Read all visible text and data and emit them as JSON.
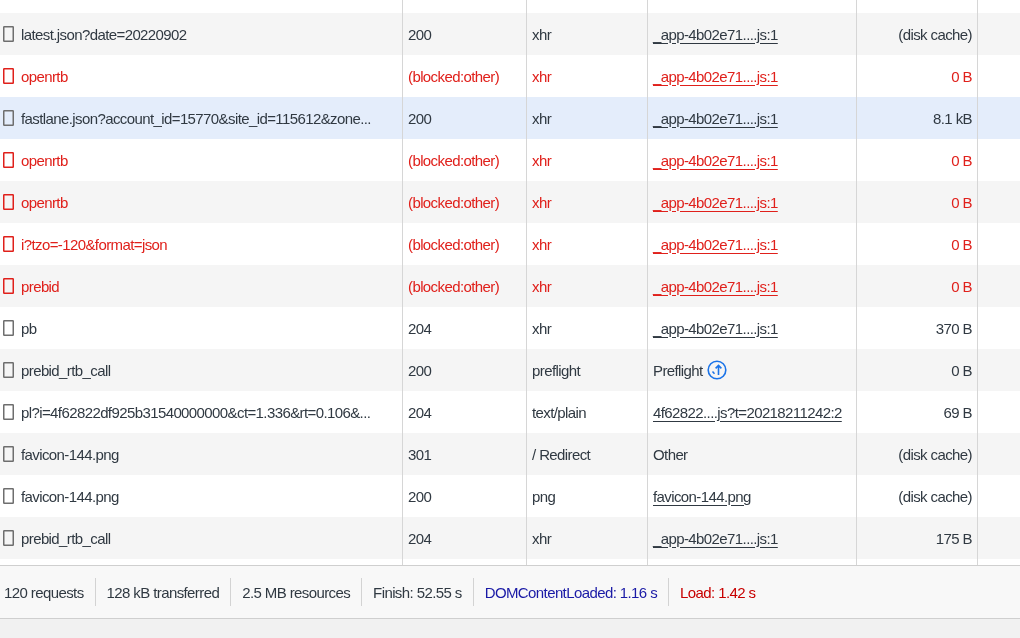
{
  "table": {
    "rows": [
      {
        "name": "latest.json?date=20220902",
        "status": "200",
        "type": "xhr",
        "initiator": {
          "text": "_app-4b02e71....js:1",
          "kind": "link"
        },
        "size": "(disk cache)",
        "blocked": false,
        "selected": false
      },
      {
        "name": "openrtb",
        "status": "(blocked:other)",
        "type": "xhr",
        "initiator": {
          "text": "_app-4b02e71....js:1",
          "kind": "link"
        },
        "size": "0 B",
        "blocked": true,
        "selected": false
      },
      {
        "name": "fastlane.json?account_id=15770&site_id=115612&zone...",
        "status": "200",
        "type": "xhr",
        "initiator": {
          "text": "_app-4b02e71....js:1",
          "kind": "link"
        },
        "size": "8.1 kB",
        "blocked": false,
        "selected": true
      },
      {
        "name": "openrtb",
        "status": "(blocked:other)",
        "type": "xhr",
        "initiator": {
          "text": "_app-4b02e71....js:1",
          "kind": "link"
        },
        "size": "0 B",
        "blocked": true,
        "selected": false
      },
      {
        "name": "openrtb",
        "status": "(blocked:other)",
        "type": "xhr",
        "initiator": {
          "text": "_app-4b02e71....js:1",
          "kind": "link"
        },
        "size": "0 B",
        "blocked": true,
        "selected": false
      },
      {
        "name": "i?tzo=-120&format=json",
        "status": "(blocked:other)",
        "type": "xhr",
        "initiator": {
          "text": "_app-4b02e71....js:1",
          "kind": "link"
        },
        "size": "0 B",
        "blocked": true,
        "selected": false
      },
      {
        "name": "prebid",
        "status": "(blocked:other)",
        "type": "xhr",
        "initiator": {
          "text": "_app-4b02e71....js:1",
          "kind": "link"
        },
        "size": "0 B",
        "blocked": true,
        "selected": false
      },
      {
        "name": "pb",
        "status": "204",
        "type": "xhr",
        "initiator": {
          "text": "_app-4b02e71....js:1",
          "kind": "link"
        },
        "size": "370 B",
        "blocked": false,
        "selected": false
      },
      {
        "name": "prebid_rtb_call",
        "status": "200",
        "type": "preflight",
        "initiator": {
          "text": "Preflight",
          "kind": "preflight"
        },
        "size": "0 B",
        "blocked": false,
        "selected": false
      },
      {
        "name": "pl?i=4f62822df925b31540000000&ct=1.336&rt=0.106&...",
        "status": "204",
        "type": "text/plain",
        "initiator": {
          "text": "4f62822....js?t=20218211242:2",
          "kind": "link"
        },
        "size": "69 B",
        "blocked": false,
        "selected": false
      },
      {
        "name": "favicon-144.png",
        "status": "301",
        "type": "/ Redirect",
        "initiator": {
          "text": "Other",
          "kind": "plain"
        },
        "size": "(disk cache)",
        "blocked": false,
        "selected": false
      },
      {
        "name": "favicon-144.png",
        "status": "200",
        "type": "png",
        "initiator": {
          "text": "favicon-144.png",
          "kind": "link"
        },
        "size": "(disk cache)",
        "blocked": false,
        "selected": false
      },
      {
        "name": "prebid_rtb_call",
        "status": "204",
        "type": "xhr",
        "initiator": {
          "text": "_app-4b02e71....js:1",
          "kind": "link"
        },
        "size": "175 B",
        "blocked": false,
        "selected": false
      }
    ]
  },
  "status_bar": {
    "items": [
      {
        "text": "120 requests",
        "kind": "plain"
      },
      {
        "text": "128 kB transferred",
        "kind": "plain"
      },
      {
        "text": "2.5 MB resources",
        "kind": "plain"
      },
      {
        "text": "Finish: 52.55 s",
        "kind": "plain"
      },
      {
        "text": "DOMContentLoaded: 1.16 s",
        "kind": "dom"
      },
      {
        "text": "Load: 1.42 s",
        "kind": "load"
      }
    ]
  }
}
